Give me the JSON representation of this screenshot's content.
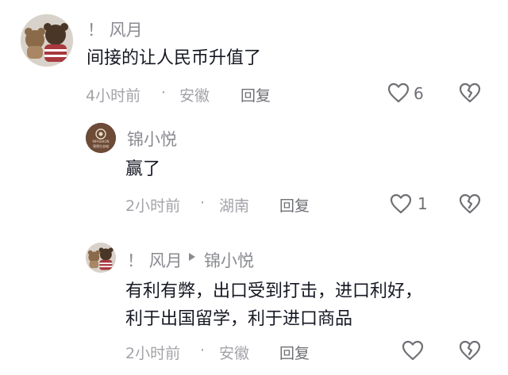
{
  "comments": [
    {
      "username": "！ 风月",
      "text": "间接的让人民币升值了",
      "time": "4小时前",
      "location": "安徽",
      "reply_label": "回复",
      "likes": "6"
    },
    {
      "username": "锦小悦",
      "avatar_text": "MFASHION",
      "avatar_text2": "锦锦生态城",
      "text": "赢了",
      "time": "2小时前",
      "location": "湖南",
      "reply_label": "回复",
      "likes": "1"
    },
    {
      "username": "！ 风月",
      "reply_to": "锦小悦",
      "text_line1": "有利有弊，出口受到打击，进口利好，",
      "text_line2": "利于出国留学，利于进口商品",
      "time": "2小时前",
      "location": "安徽",
      "reply_label": "回复",
      "likes": ""
    }
  ],
  "dot": "·"
}
